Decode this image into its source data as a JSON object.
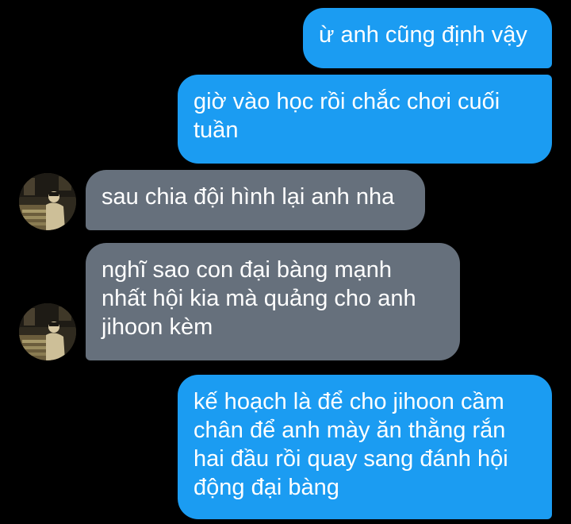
{
  "conversation": {
    "messages": [
      {
        "direction": "sent",
        "text": "ừ anh cũng định vậy"
      },
      {
        "direction": "sent",
        "text": "giờ vào học rồi chắc chơi cuối\ntuần"
      },
      {
        "direction": "received",
        "text": "sau chia đội hình lại anh nha"
      },
      {
        "direction": "received",
        "text": "nghĩ sao con đại bàng mạnh\nnhất hội kia mà quảng cho anh\njihoon kèm"
      },
      {
        "direction": "sent",
        "text": "kế hoạch là để cho jihoon cầm\nchân để anh mày ăn thằng rắn\nhai đầu rồi quay sang đánh hội\nđộng đại bàng"
      }
    ]
  },
  "colors": {
    "background": "#000000",
    "sent_bubble": "#1b9cf2",
    "received_bubble": "#66707c",
    "text": "#ffffff"
  },
  "icons": {
    "avatar": "contact-avatar"
  }
}
